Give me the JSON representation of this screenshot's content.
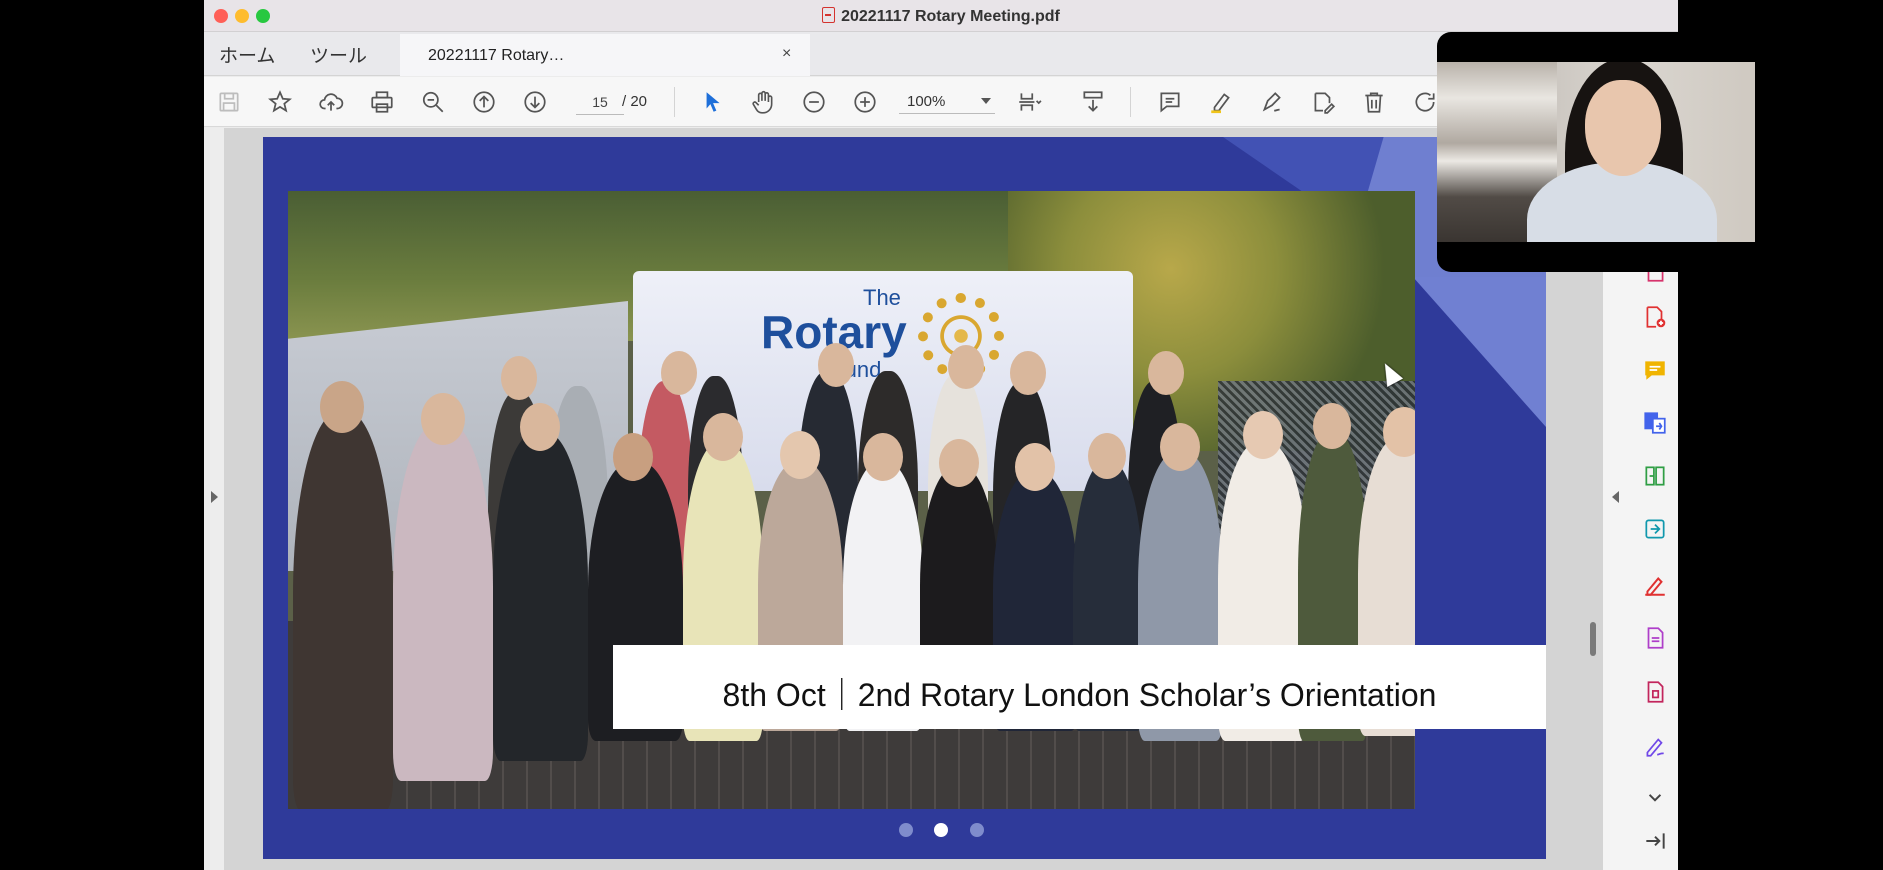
{
  "window": {
    "title": "20221117 Rotary Meeting.pdf"
  },
  "menu_tabs": {
    "home": "ホーム",
    "tools": "ツール"
  },
  "doc_tab": {
    "label": "20221117 Rotary…",
    "close": "×"
  },
  "toolbar": {
    "current_page": "15",
    "total_pages": "/ 20",
    "zoom": "100%",
    "icons": [
      "save-icon",
      "star-icon",
      "cloud-upload-icon",
      "print-icon",
      "zoom-search-icon",
      "page-up-icon",
      "page-down-icon",
      "select-pointer-icon",
      "hand-icon",
      "zoom-out-icon",
      "zoom-in-icon",
      "page-layout-icon",
      "scroll-mode-icon",
      "comment-icon",
      "highlight-icon",
      "draw-icon",
      "edit-text-icon",
      "delete-icon",
      "rotate-icon"
    ]
  },
  "slide": {
    "caption": "8th Oct｜2nd Rotary London Scholar’s Orientation",
    "banner_the": "The",
    "banner_rotary": "Rotary",
    "banner_found": "Found",
    "dots_total": 3,
    "dots_active_index": 1,
    "bg_color": "#2f3a9a"
  },
  "right_rail": {
    "icons": [
      "pdf-export-icon",
      "create-pdf-icon",
      "comment-tool-icon",
      "combine-files-icon",
      "organize-pages-icon",
      "scan-icon",
      "fill-sign-icon",
      "edit-pdf-icon",
      "compress-icon",
      "sign-icon",
      "more-chevron-icon",
      "expand-panel-icon"
    ]
  }
}
